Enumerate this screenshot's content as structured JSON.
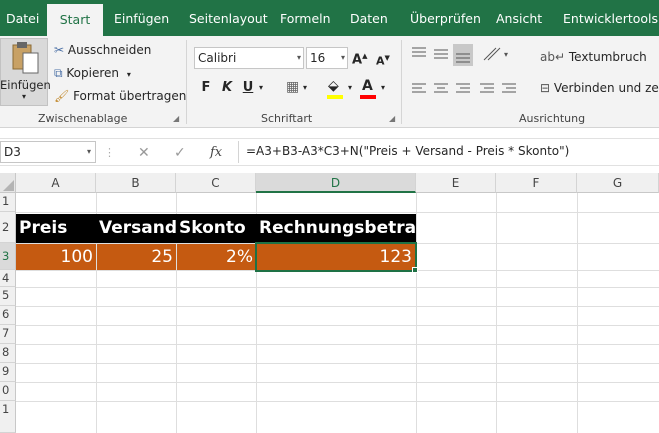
{
  "tabs": [
    "Datei",
    "Start",
    "Einfügen",
    "Seitenlayout",
    "Formeln",
    "Daten",
    "Überprüfen",
    "Ansicht",
    "Entwicklertools"
  ],
  "clipboard": {
    "paste_label": "Einfügen",
    "cut_label": "Ausschneiden",
    "copy_label": "Kopieren",
    "format_painter_label": "Format übertragen",
    "group_label": "Zwischenablage"
  },
  "font": {
    "font_name": "Calibri",
    "font_size": "16",
    "bold": "F",
    "italic": "K",
    "underline": "U",
    "group_label": "Schriftart",
    "highlight_color": "#ffff00",
    "font_color": "#ff0000"
  },
  "alignment": {
    "wrap_text_label": "Textumbruch",
    "merge_label": "Verbinden und zent",
    "group_label": "Ausrichtung"
  },
  "formula_bar": {
    "name_box": "D3",
    "fx": "fx",
    "formula": "=A3+B3-A3*C3+N(\"Preis + Versand - Preis * Skonto\")"
  },
  "sheet": {
    "columns": [
      "A",
      "B",
      "C",
      "D",
      "E",
      "F",
      "G"
    ],
    "rows": [
      "1",
      "2",
      "3",
      "4",
      "5",
      "6",
      "7",
      "8",
      "9",
      "0",
      "1"
    ],
    "selected_cell": "D3",
    "headers": [
      "Preis",
      "Versand",
      "Skonto",
      "Rechnungsbetrag"
    ],
    "values": [
      "100",
      "25",
      "2%",
      "123"
    ],
    "header_fill": "#000000",
    "data_fill": "#c55a11"
  }
}
